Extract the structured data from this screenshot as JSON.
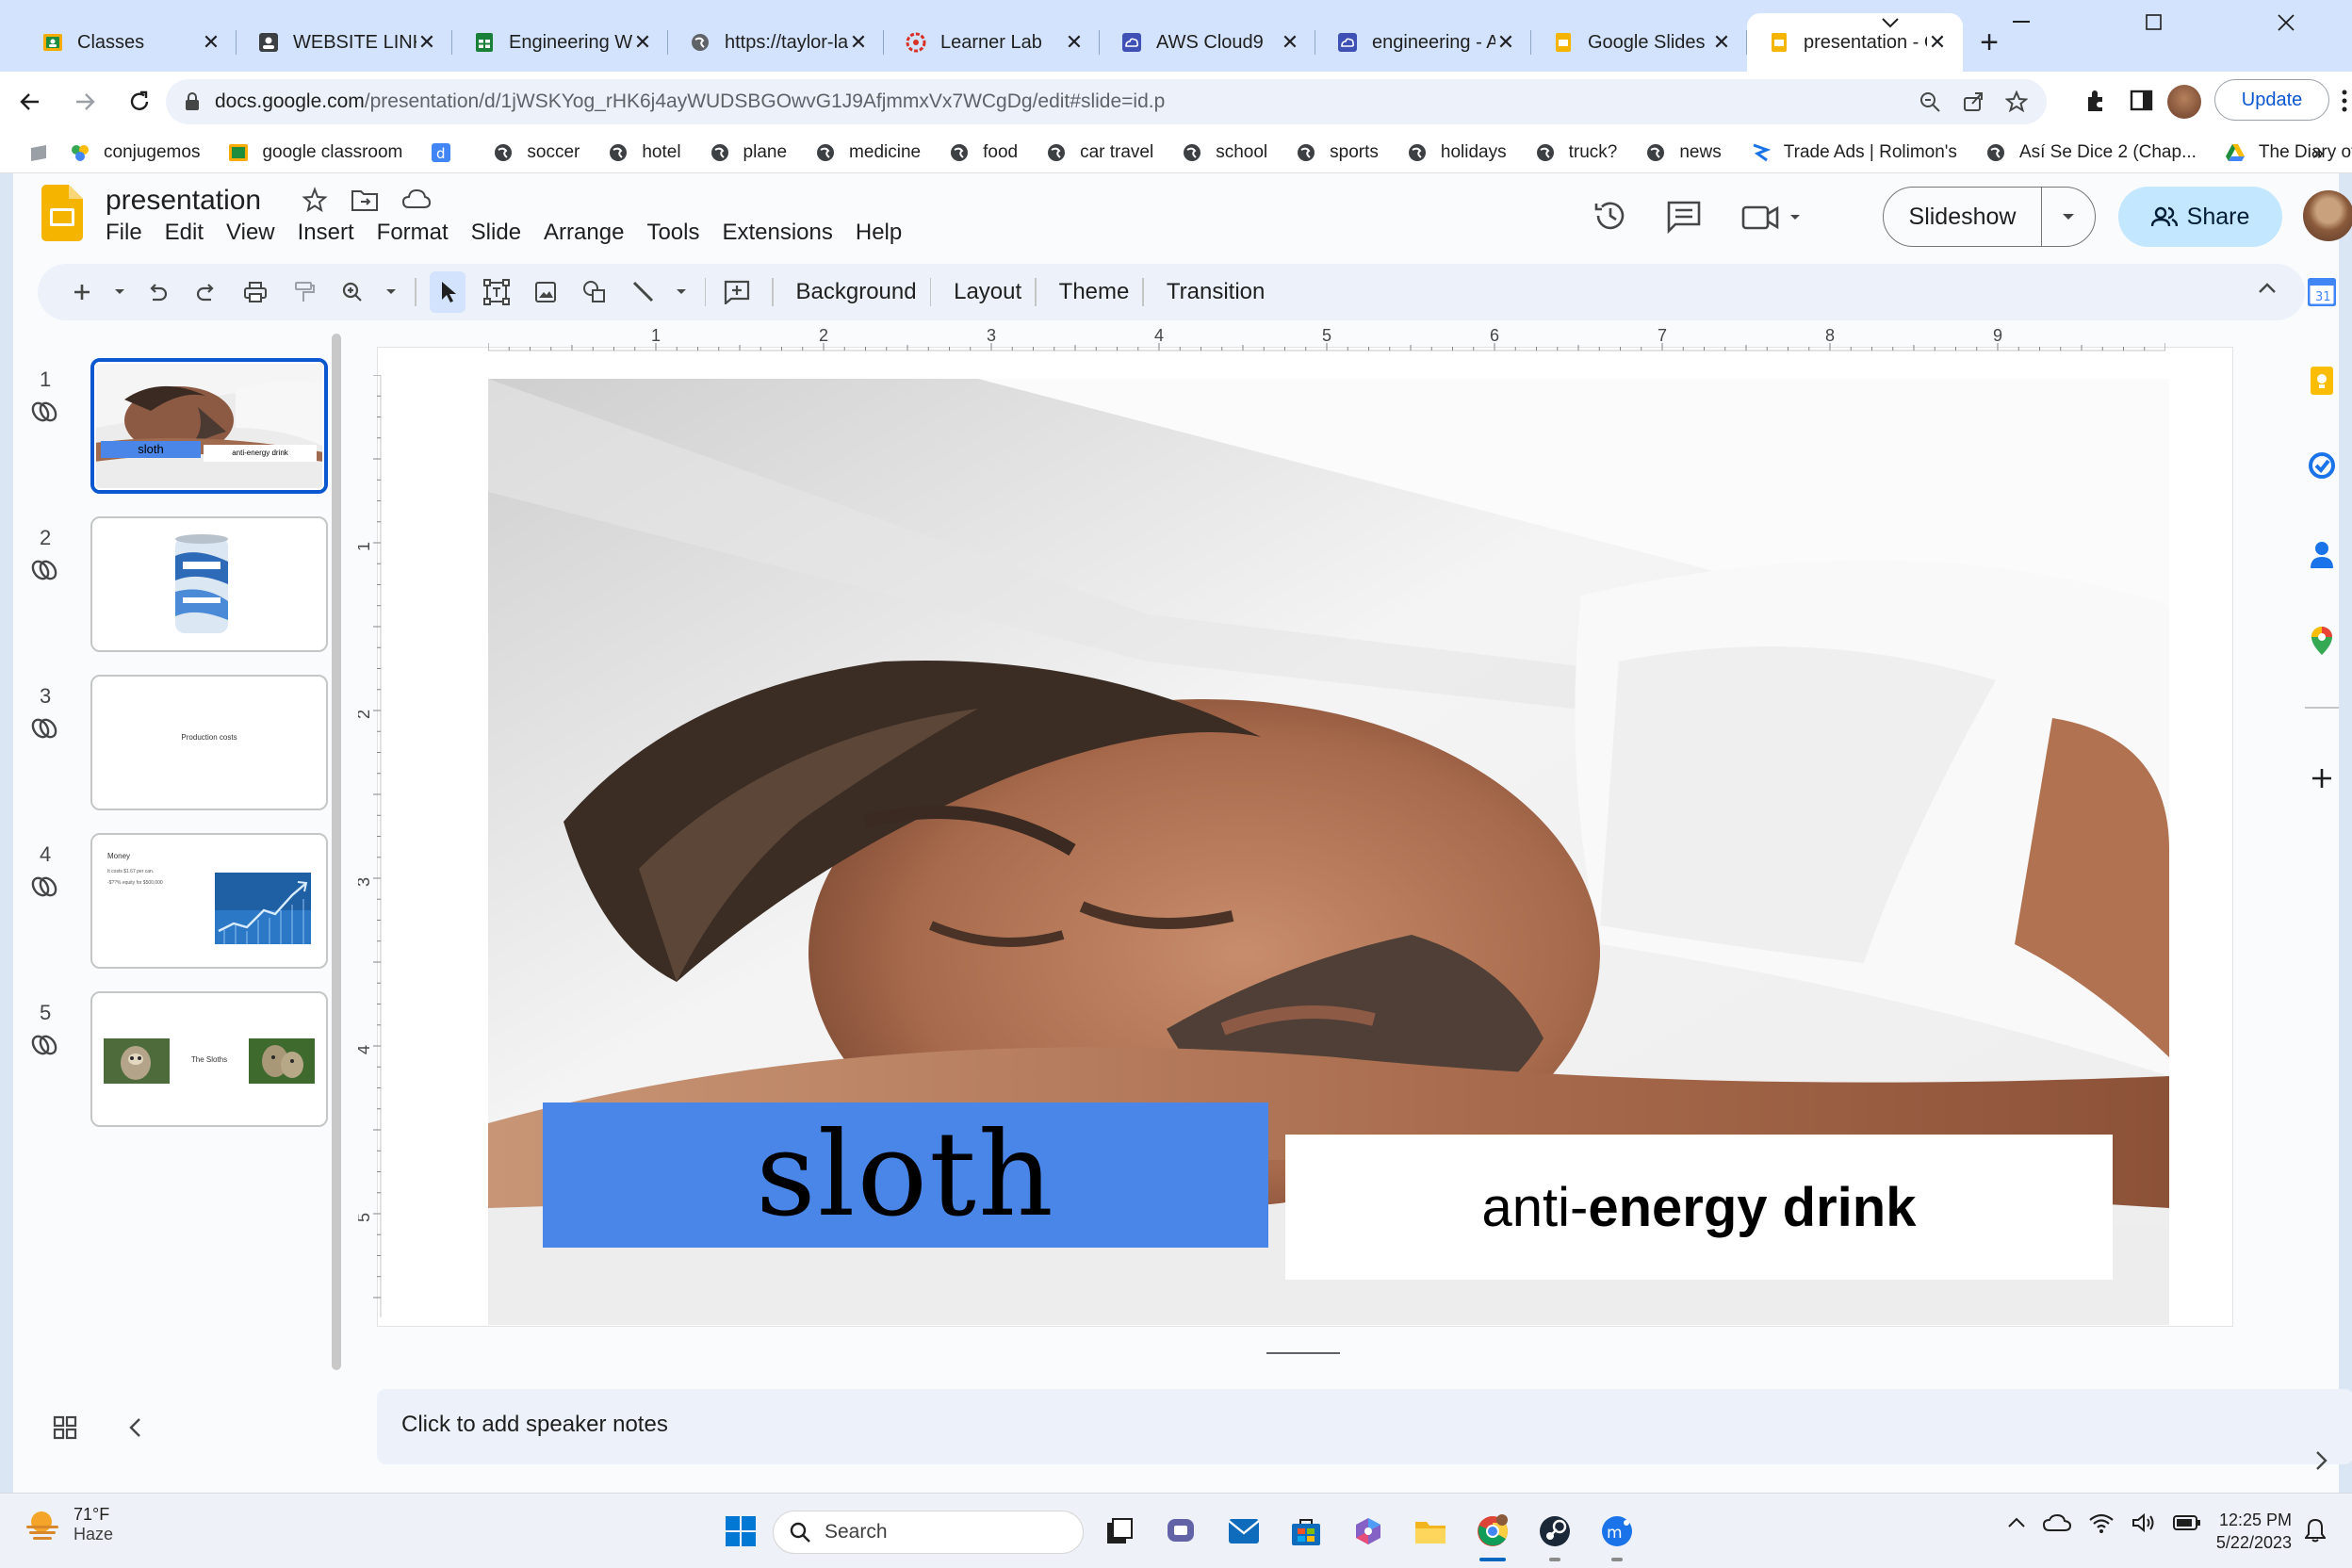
{
  "browser": {
    "tabs": [
      {
        "title": "Classes",
        "icon": "classroom-icon",
        "active": false
      },
      {
        "title": "WEBSITE LINKS (",
        "icon": "website-links-icon",
        "active": false
      },
      {
        "title": "Engineering Wel",
        "icon": "sheets-icon",
        "active": false
      },
      {
        "title": "https://taylor-la",
        "icon": "globe-icon",
        "active": false
      },
      {
        "title": "Learner Lab",
        "icon": "learner-lab-icon",
        "active": false
      },
      {
        "title": "AWS Cloud9",
        "icon": "cloud9-icon",
        "active": false
      },
      {
        "title": "engineering - AV",
        "icon": "cloud9-icon",
        "active": false
      },
      {
        "title": "Google Slides",
        "icon": "slides-icon",
        "active": false
      },
      {
        "title": "presentation - G",
        "icon": "slides-icon",
        "active": true
      }
    ],
    "url_host": "docs.google.com",
    "url_path": "/presentation/d/1jWSKYog_rHK6j4ayWUDSBGOwvG1J9AfjmmxVx7WCgDg/edit#slide=id.p",
    "update_label": "Update",
    "bookmarks": [
      {
        "label": "conjugemos",
        "icon": "conjugemos-icon"
      },
      {
        "label": "google classroom",
        "icon": "classroom-icon"
      },
      {
        "label": "",
        "icon": "d-icon"
      },
      {
        "label": "soccer",
        "icon": "globe-icon"
      },
      {
        "label": "hotel",
        "icon": "globe-icon"
      },
      {
        "label": "plane",
        "icon": "globe-icon"
      },
      {
        "label": "medicine",
        "icon": "globe-icon"
      },
      {
        "label": "food",
        "icon": "globe-icon"
      },
      {
        "label": "car travel",
        "icon": "globe-icon"
      },
      {
        "label": "school",
        "icon": "globe-icon"
      },
      {
        "label": "sports",
        "icon": "globe-icon"
      },
      {
        "label": "holidays",
        "icon": "globe-icon"
      },
      {
        "label": "truck?",
        "icon": "globe-icon"
      },
      {
        "label": "news",
        "icon": "globe-icon"
      },
      {
        "label": "Trade Ads | Rolimon's",
        "icon": "rolimons-icon"
      },
      {
        "label": "Así Se Dice 2 (Chap...",
        "icon": "globe-icon"
      },
      {
        "label": "The Diary of Anne F...",
        "icon": "drive-icon"
      }
    ]
  },
  "slides": {
    "doc_title": "presentation",
    "menus": [
      "File",
      "Edit",
      "View",
      "Insert",
      "Format",
      "Slide",
      "Arrange",
      "Tools",
      "Extensions",
      "Help"
    ],
    "slideshow_label": "Slideshow",
    "share_label": "Share",
    "toolbar_text": [
      "Background",
      "Layout",
      "Theme",
      "Transition"
    ],
    "ruler_h": [
      "1",
      "2",
      "3",
      "4",
      "5",
      "6",
      "7",
      "8",
      "9"
    ],
    "ruler_v": [
      "1",
      "2",
      "3",
      "4",
      "5"
    ],
    "filmstrip": [
      {
        "num": "1",
        "sloth": "sloth",
        "anti": "anti-energy drink"
      },
      {
        "num": "2"
      },
      {
        "num": "3",
        "text": "Production costs"
      },
      {
        "num": "4",
        "title": "Money",
        "line1": "It costs $1.67 per can.",
        "line2": "-$??% equity for $500,000"
      },
      {
        "num": "5",
        "text": "The Sloths"
      }
    ],
    "current_slide": {
      "title": "sloth",
      "subtitle_prefix": "anti-",
      "subtitle_bold": "energy drink"
    },
    "speaker_notes_placeholder": "Click to add speaker notes",
    "colors": {
      "title_box": "#4a86e8",
      "accent": "#0b57d0",
      "share_bg": "#c2e7ff"
    }
  },
  "taskbar": {
    "temp": "71°F",
    "condition": "Haze",
    "search_placeholder": "Search",
    "time": "12:25 PM",
    "date": "5/22/2023"
  }
}
